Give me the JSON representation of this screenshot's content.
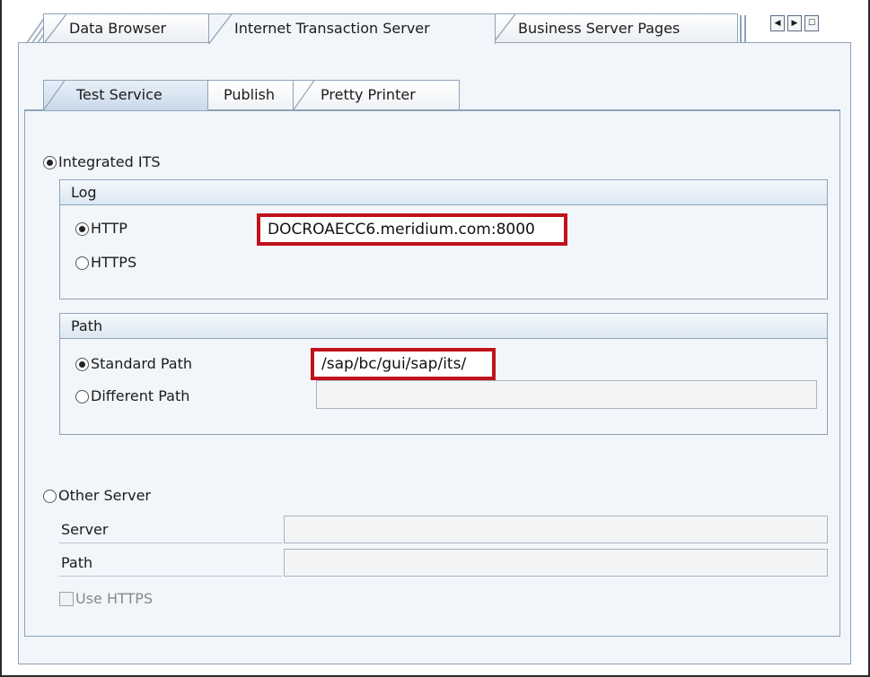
{
  "top_tabs": [
    {
      "label": "Data Browser"
    },
    {
      "label": "Internet Transaction Server"
    },
    {
      "label": "Business Server Pages"
    }
  ],
  "nav_buttons": {
    "prev": "◀",
    "next": "▶",
    "list": "☐"
  },
  "sub_tabs": [
    {
      "label": "Test Service"
    },
    {
      "label": "Publish"
    },
    {
      "label": "Pretty Printer"
    }
  ],
  "integrated_its": {
    "label": "Integrated ITS",
    "selected": true
  },
  "log_group": {
    "title": "Log",
    "http_label": "HTTP",
    "https_label": "HTTPS",
    "server_value": "DOCROAECC6.meridium.com:8000"
  },
  "path_group": {
    "title": "Path",
    "standard_label": "Standard Path",
    "different_label": "Different Path",
    "standard_value": "/sap/bc/gui/sap/its/"
  },
  "other_server": {
    "label": "Other Server",
    "server_label": "Server",
    "path_label": "Path",
    "use_https_label": "Use HTTPS"
  }
}
